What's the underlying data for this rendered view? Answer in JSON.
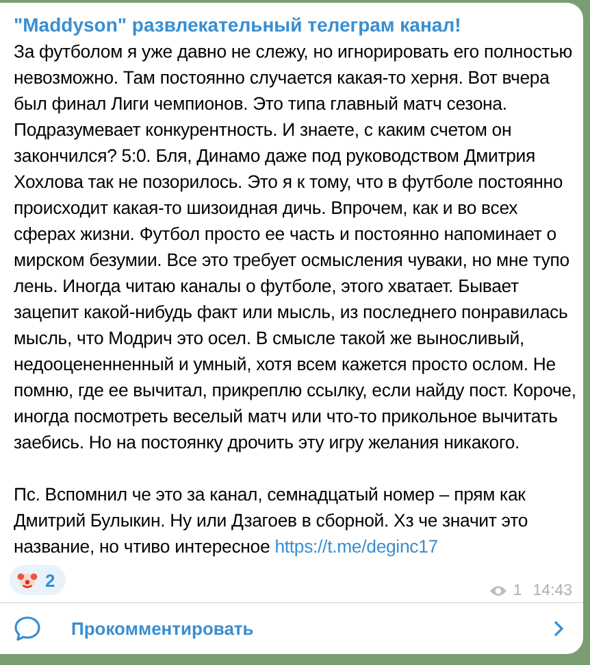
{
  "message": {
    "channel_title": "\"Maddyson\" развлекательный телеграм канал!",
    "body": "За футболом я уже давно не слежу, но игнорировать его полностью невозможно. Там постоянно случается какая-то херня. Вот вчера был финал Лиги чемпионов. Это типа главный матч сезона. Подразумевает конкурентность. И знаете, с каким счетом он закончился? 5:0. Бля, Динамо даже под руководством Дмитрия Хохлова так не позорилось. Это я к тому, что в футболе постоянно происходит какая-то шизоидная дичь. Впрочем, как и во всех сферах жизни. Футбол просто ее часть и постоянно напоминает о мирском безумии. Все это требует осмысления чуваки, но мне тупо лень. Иногда читаю каналы о футболе, этого хватает. Бывает зацепит какой-нибудь факт или мысль, из последнего понравилась мысль, что Модрич это осел. В смысле такой же выносливый, недооцененненный и умный, хотя всем кажется просто ослом. Не помню, где ее вычитал, прикреплю ссылку, если найду пост. Короче, иногда посмотреть веселый матч или что-то прикольное вычитать заебись. Но на постоянку дрочить эту игру желания никакого.",
    "postscript": "Пс. Вспомнил че это за канал, семнадцатый номер – прям как Дмитрий Булыкин. Ну или Дзагоев в сборной. Хз че значит это название, но чтиво интересное",
    "link": "https://t.me/deginc17",
    "reactions": [
      {
        "count": "2"
      }
    ],
    "views": "1",
    "time": "14:43"
  },
  "comment_button": {
    "label": "Прокомментировать"
  }
}
